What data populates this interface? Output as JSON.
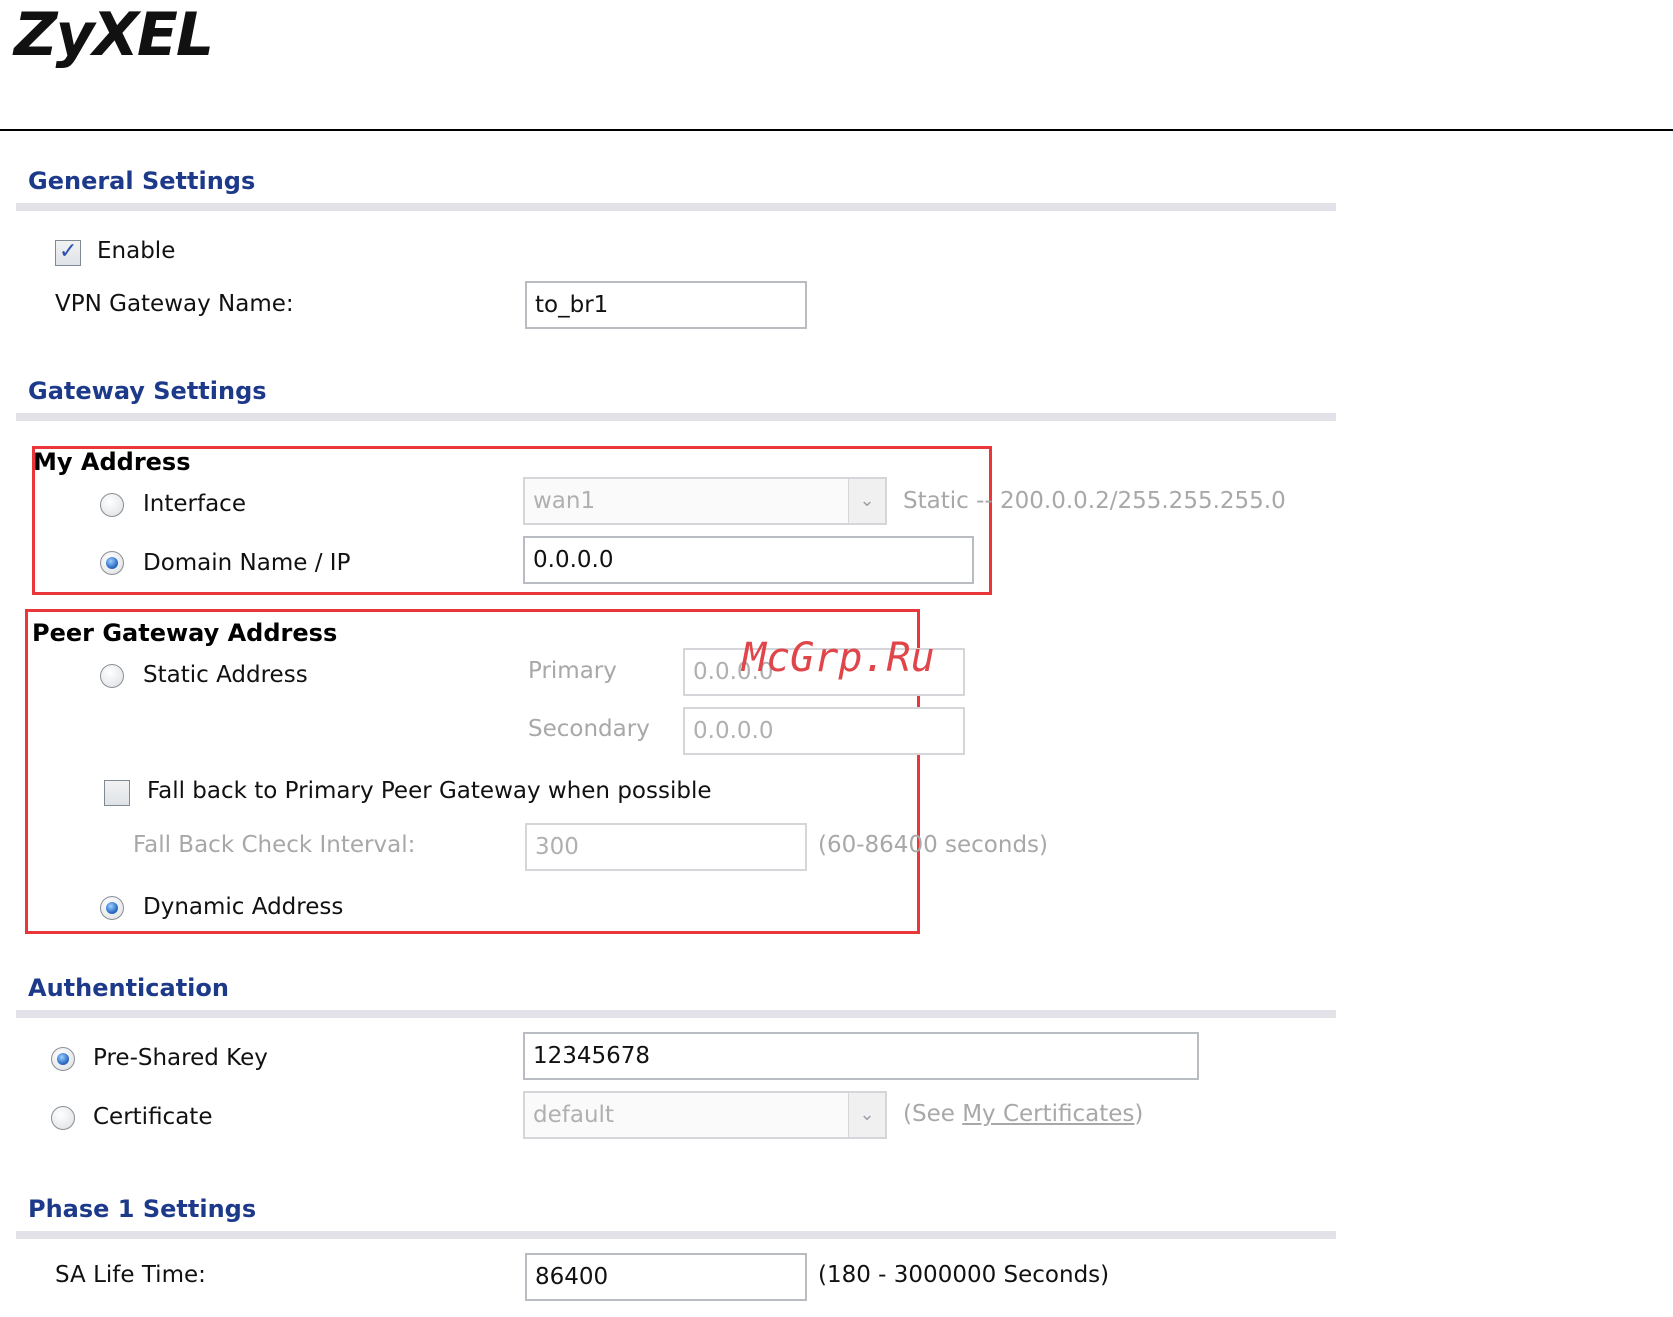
{
  "brand": {
    "logo": "ZyXEL"
  },
  "watermark": "McGrp.Ru",
  "sections": {
    "general": {
      "title": "General Settings"
    },
    "gateway": {
      "title": "Gateway Settings"
    },
    "auth": {
      "title": "Authentication"
    },
    "phase1": {
      "title": "Phase 1 Settings"
    }
  },
  "general": {
    "enable_label": "Enable",
    "enable_checked": true,
    "vpn_name_label": "VPN Gateway Name:",
    "vpn_name_value": "to_br1"
  },
  "my_address": {
    "title": "My Address",
    "interface_label": "Interface",
    "interface_select": "wan1",
    "interface_hint": "Static -- 200.0.0.2/255.255.255.0",
    "domain_label": "Domain Name / IP",
    "domain_value": "0.0.0.0"
  },
  "peer": {
    "title": "Peer Gateway Address",
    "static_label": "Static Address",
    "primary_label": "Primary",
    "primary_value": "0.0.0.0",
    "secondary_label": "Secondary",
    "secondary_value": "0.0.0.0",
    "fallback_label": "Fall back to Primary Peer Gateway when possible",
    "interval_label": "Fall Back Check Interval:",
    "interval_value": "300",
    "interval_hint": "(60-86400 seconds)",
    "dynamic_label": "Dynamic Address"
  },
  "auth": {
    "psk_label": "Pre-Shared Key",
    "psk_value": "12345678",
    "cert_label": "Certificate",
    "cert_select": "default",
    "cert_hint_prefix": "(See ",
    "cert_hint_link": "My Certificates",
    "cert_hint_suffix": ")"
  },
  "phase1": {
    "sa_label": "SA Life Time:",
    "sa_value": "86400",
    "sa_hint": "(180 - 3000000 Seconds)"
  },
  "colors": {
    "section_title": "#1d3a8a",
    "highlight_box": "#e8363a",
    "disabled_text": "#a8a8a8"
  }
}
